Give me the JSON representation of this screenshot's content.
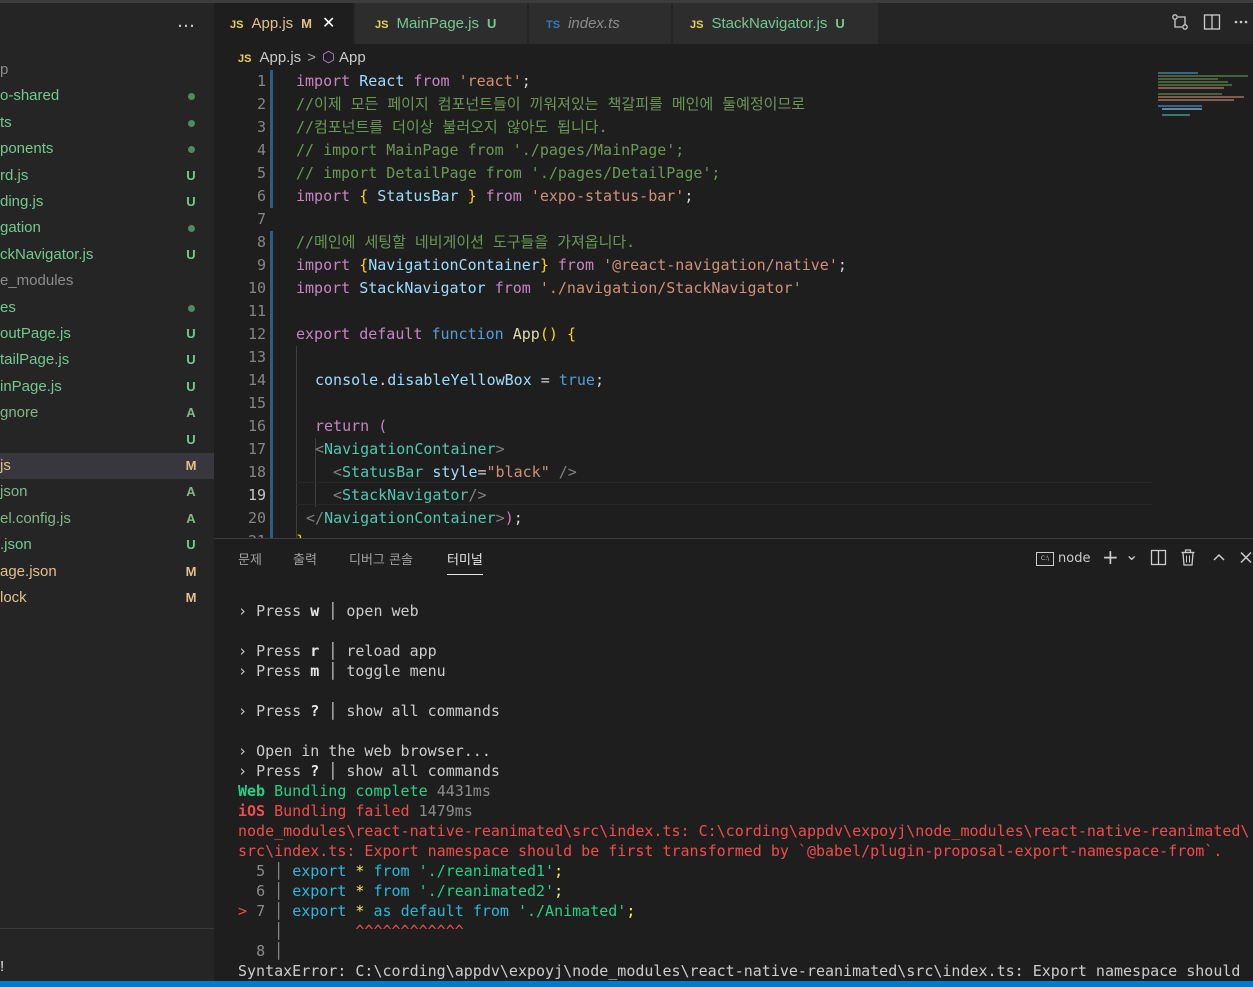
{
  "sidebar": {
    "more_icon": "…",
    "items": [
      {
        "label": "p",
        "status": ""
      },
      {
        "label": "o-shared",
        "status": "dot"
      },
      {
        "label": "ts",
        "status": "dot"
      },
      {
        "label": "ponents",
        "status": "dot"
      },
      {
        "label": "rd.js",
        "status": "U"
      },
      {
        "label": "ding.js",
        "status": "U"
      },
      {
        "label": "gation",
        "status": "dot"
      },
      {
        "label": "ckNavigator.js",
        "status": "U"
      },
      {
        "label": "e_modules",
        "status": ""
      },
      {
        "label": "es",
        "status": "dot"
      },
      {
        "label": "outPage.js",
        "status": "U"
      },
      {
        "label": "tailPage.js",
        "status": "U"
      },
      {
        "label": "inPage.js",
        "status": "U"
      },
      {
        "label": "gnore",
        "status": "A"
      },
      {
        "label": "",
        "status": "U"
      },
      {
        "label": "js",
        "status": "M"
      },
      {
        "label": "json",
        "status": "A"
      },
      {
        "label": "el.config.js",
        "status": "A"
      },
      {
        "label": ".json",
        "status": "U"
      },
      {
        "label": "age.json",
        "status": "M"
      },
      {
        "label": "lock",
        "status": "M"
      }
    ],
    "bottom_label": "!"
  },
  "tabs": [
    {
      "icon": "JS",
      "label": "App.js",
      "status": "M",
      "close": "✕"
    },
    {
      "icon": "JS",
      "label": "MainPage.js",
      "status": "U"
    },
    {
      "icon": "TS",
      "label": "index.ts",
      "status": ""
    },
    {
      "icon": "JS",
      "label": "StackNavigator.js",
      "status": "U"
    }
  ],
  "breadcrumb": {
    "icon": "JS",
    "file": "App.js",
    "separator": ">",
    "symbol_icon": "⬡",
    "symbol": "App"
  },
  "editor": {
    "current_line": 19,
    "lines": [
      {
        "n": "1",
        "t": ""
      },
      {
        "n": "2",
        "t": "//이제 모든 페이지 컴포넌트들이 끼워져있는 책갈피를 메인에 둘예정이므로"
      },
      {
        "n": "3",
        "t": "//컴포넌트를 더이상 불러오지 않아도 됩니다."
      },
      {
        "n": "4",
        "t": "// import MainPage from './pages/MainPage';"
      },
      {
        "n": "5",
        "t": "// import DetailPage from './pages/DetailPage';"
      },
      {
        "n": "6",
        "t": ""
      },
      {
        "n": "7",
        "t": ""
      },
      {
        "n": "8",
        "t": "//메인에 세팅할 네비게이션 도구들을 가져옵니다."
      },
      {
        "n": "9",
        "t": ""
      },
      {
        "n": "10",
        "t": ""
      },
      {
        "n": "11",
        "t": ""
      },
      {
        "n": "12",
        "t": ""
      },
      {
        "n": "13",
        "t": ""
      },
      {
        "n": "14",
        "t": ""
      },
      {
        "n": "15",
        "t": ""
      },
      {
        "n": "16",
        "t": ""
      },
      {
        "n": "17",
        "t": ""
      },
      {
        "n": "18",
        "t": ""
      },
      {
        "n": "19",
        "t": ""
      },
      {
        "n": "20",
        "t": ""
      },
      {
        "n": "21",
        "t": ""
      }
    ],
    "tokens": {
      "import": "import",
      "from": "from",
      "React": "React",
      "react_str": "'react'",
      "semi": ";",
      "ob": "{",
      "cb": "}",
      "StatusBar": "StatusBar",
      "expo_status_bar": "'expo-status-bar'",
      "NavigationContainer": "NavigationContainer",
      "react_navigation_native": "'@react-navigation/native'",
      "StackNavigator": "StackNavigator",
      "nav_path": "'./navigation/StackNavigator'",
      "export": "export",
      "default": "default",
      "function": "function",
      "App": "App",
      "parens": "()",
      "console": "console",
      "dot": ".",
      "disableYellowBox": "disableYellowBox",
      "eq": " = ",
      "true": "true",
      "return": "return",
      "lparen": "(",
      "rparen": ")",
      "lt": "<",
      "gt": ">",
      "close_lt": "</",
      "self_close": " />",
      "self_close_tight": "/>",
      "style": "style",
      "eqs": "=",
      "black_str": "\"black\""
    }
  },
  "panel": {
    "tabs": [
      "문제",
      "출력",
      "디버그 콘솔",
      "터미널"
    ],
    "active_tab": "터미널",
    "terminal_name": "node",
    "add_icon": "+",
    "chevron_icon": "⌄",
    "split_icon": "▥",
    "trash_icon": "🗑",
    "maximize_icon": "⌃",
    "close_icon": "✕",
    "term_icon_text": "C:\\"
  },
  "terminal": {
    "arrow": "›",
    "press": "Press",
    "bar": "│",
    "keys": {
      "w": "w",
      "r": "r",
      "m": "m",
      "q": "?"
    },
    "cmds": {
      "open_web": "open web",
      "reload_app": "reload app",
      "toggle_menu": "toggle menu",
      "show_all": "show all commands"
    },
    "open_browser": "Open in the web browser...",
    "web": "Web",
    "bundling": "Bundling",
    "complete": "complete",
    "web_time": "4431ms",
    "ios": "iOS",
    "failed": "Bundling failed",
    "ios_time": "1479ms",
    "err1": "node_modules\\react-native-reanimated\\src\\index.ts: C:\\cording\\appdv\\expoyj\\node_modules\\react-native-reanimated\\",
    "err2": "src\\index.ts: Export namespace should be first transformed by `@babel/plugin-proposal-export-namespace-from`.",
    "code": [
      {
        "n": "5",
        "export": "export",
        "star": "*",
        "from": "from",
        "str": "'./reanimated1'",
        "semi": ";"
      },
      {
        "n": "6",
        "export": "export",
        "star": "*",
        "from": "from",
        "str": "'./reanimated2'",
        "semi": ";"
      }
    ],
    "l7": {
      "marker": ">",
      "n": "7",
      "export": "export",
      "star": "*",
      "as": "as",
      "default": "default",
      "from": "from",
      "str": "'./Animated'",
      "semi": ";"
    },
    "carets": "^^^^^^^^^^^^",
    "l8": "8",
    "syntax_err": "SyntaxError: C:\\cording\\appdv\\expoyj\\node_modules\\react-native-reanimated\\src\\index.ts: Export namespace should"
  },
  "colors": {
    "accent": "#007acc",
    "modified": "#e2c08d",
    "untracked": "#73c991",
    "error": "#f14c4c",
    "success": "#23d18b"
  }
}
